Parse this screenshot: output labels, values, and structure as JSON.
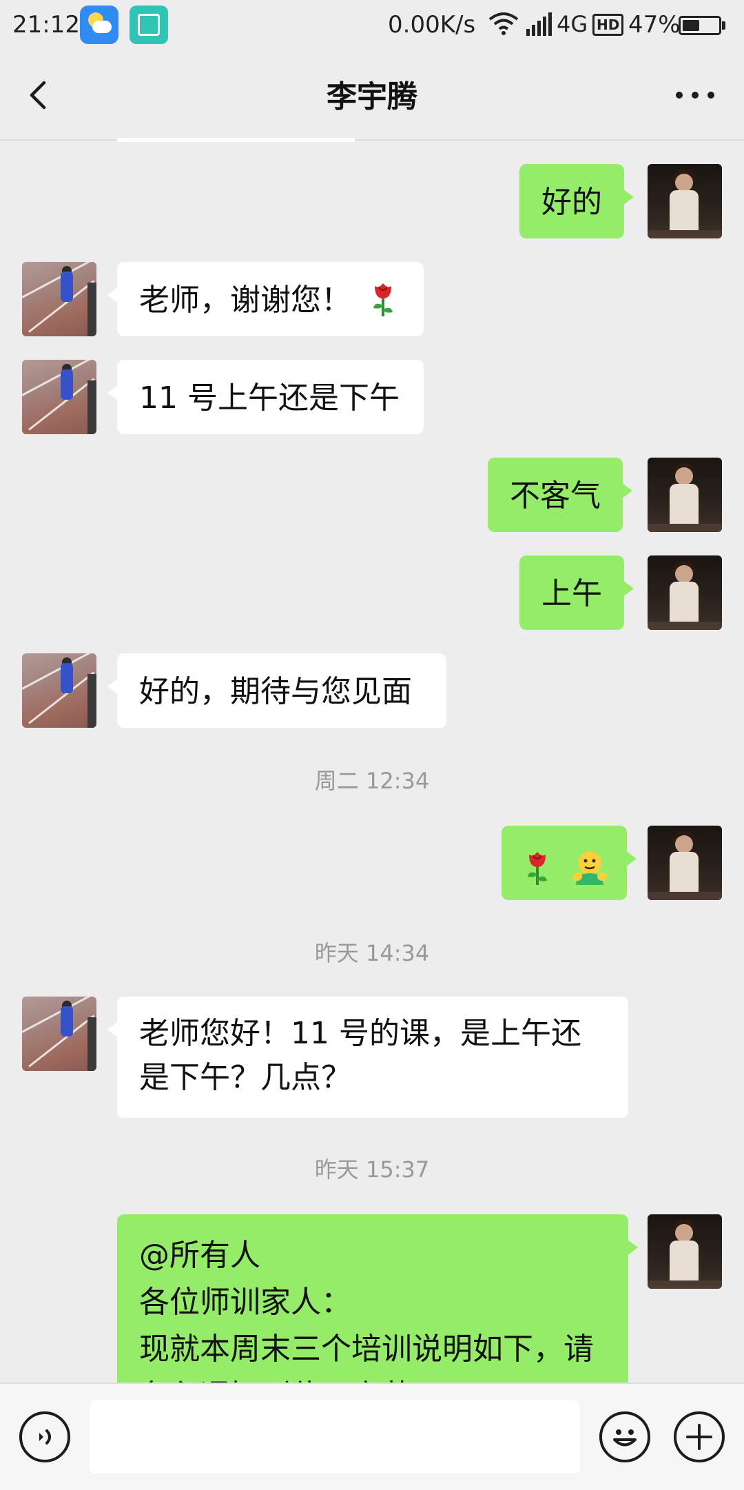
{
  "status_bar": {
    "time": "21:12",
    "network_speed": "0.00K/s",
    "network_type": "4G",
    "hd_label": "HD",
    "battery_percent": "47%",
    "battery_level": 0.47
  },
  "nav": {
    "title": "李宇腾",
    "back_icon": "chevron-left-icon",
    "more_icon": "more-dots-icon"
  },
  "messages": [
    {
      "sender": "self",
      "text": "好的"
    },
    {
      "sender": "other",
      "text": "老师，谢谢您！",
      "emoji": "rose"
    },
    {
      "sender": "other",
      "text": "11 号上午还是下午"
    },
    {
      "sender": "self",
      "text": "不客气"
    },
    {
      "sender": "self",
      "text": "上午"
    },
    {
      "sender": "other",
      "text": "好的，期待与您见面"
    },
    {
      "timestamp": "周二 12:34"
    },
    {
      "sender": "self",
      "emoji": [
        "rose",
        "hug"
      ]
    },
    {
      "timestamp": "昨天 14:34"
    },
    {
      "sender": "other",
      "text_lines": [
        "老师您好！11 号的课，是上午还",
        "是下午？几点？"
      ]
    },
    {
      "timestamp": "昨天 15:37"
    },
    {
      "sender": "self",
      "text_lines": [
        "@所有人",
        "各位师训家人：",
        "现就本周末三个培训说明如下，请",
        "务必通知到位，辛苦！"
      ]
    }
  ],
  "input_bar": {
    "voice_icon": "voice-icon",
    "emoji_icon": "smiley-icon",
    "plus_icon": "plus-icon"
  },
  "colors": {
    "self_bubble": "#95ec69",
    "other_bubble": "#ffffff",
    "background": "#ededed"
  }
}
